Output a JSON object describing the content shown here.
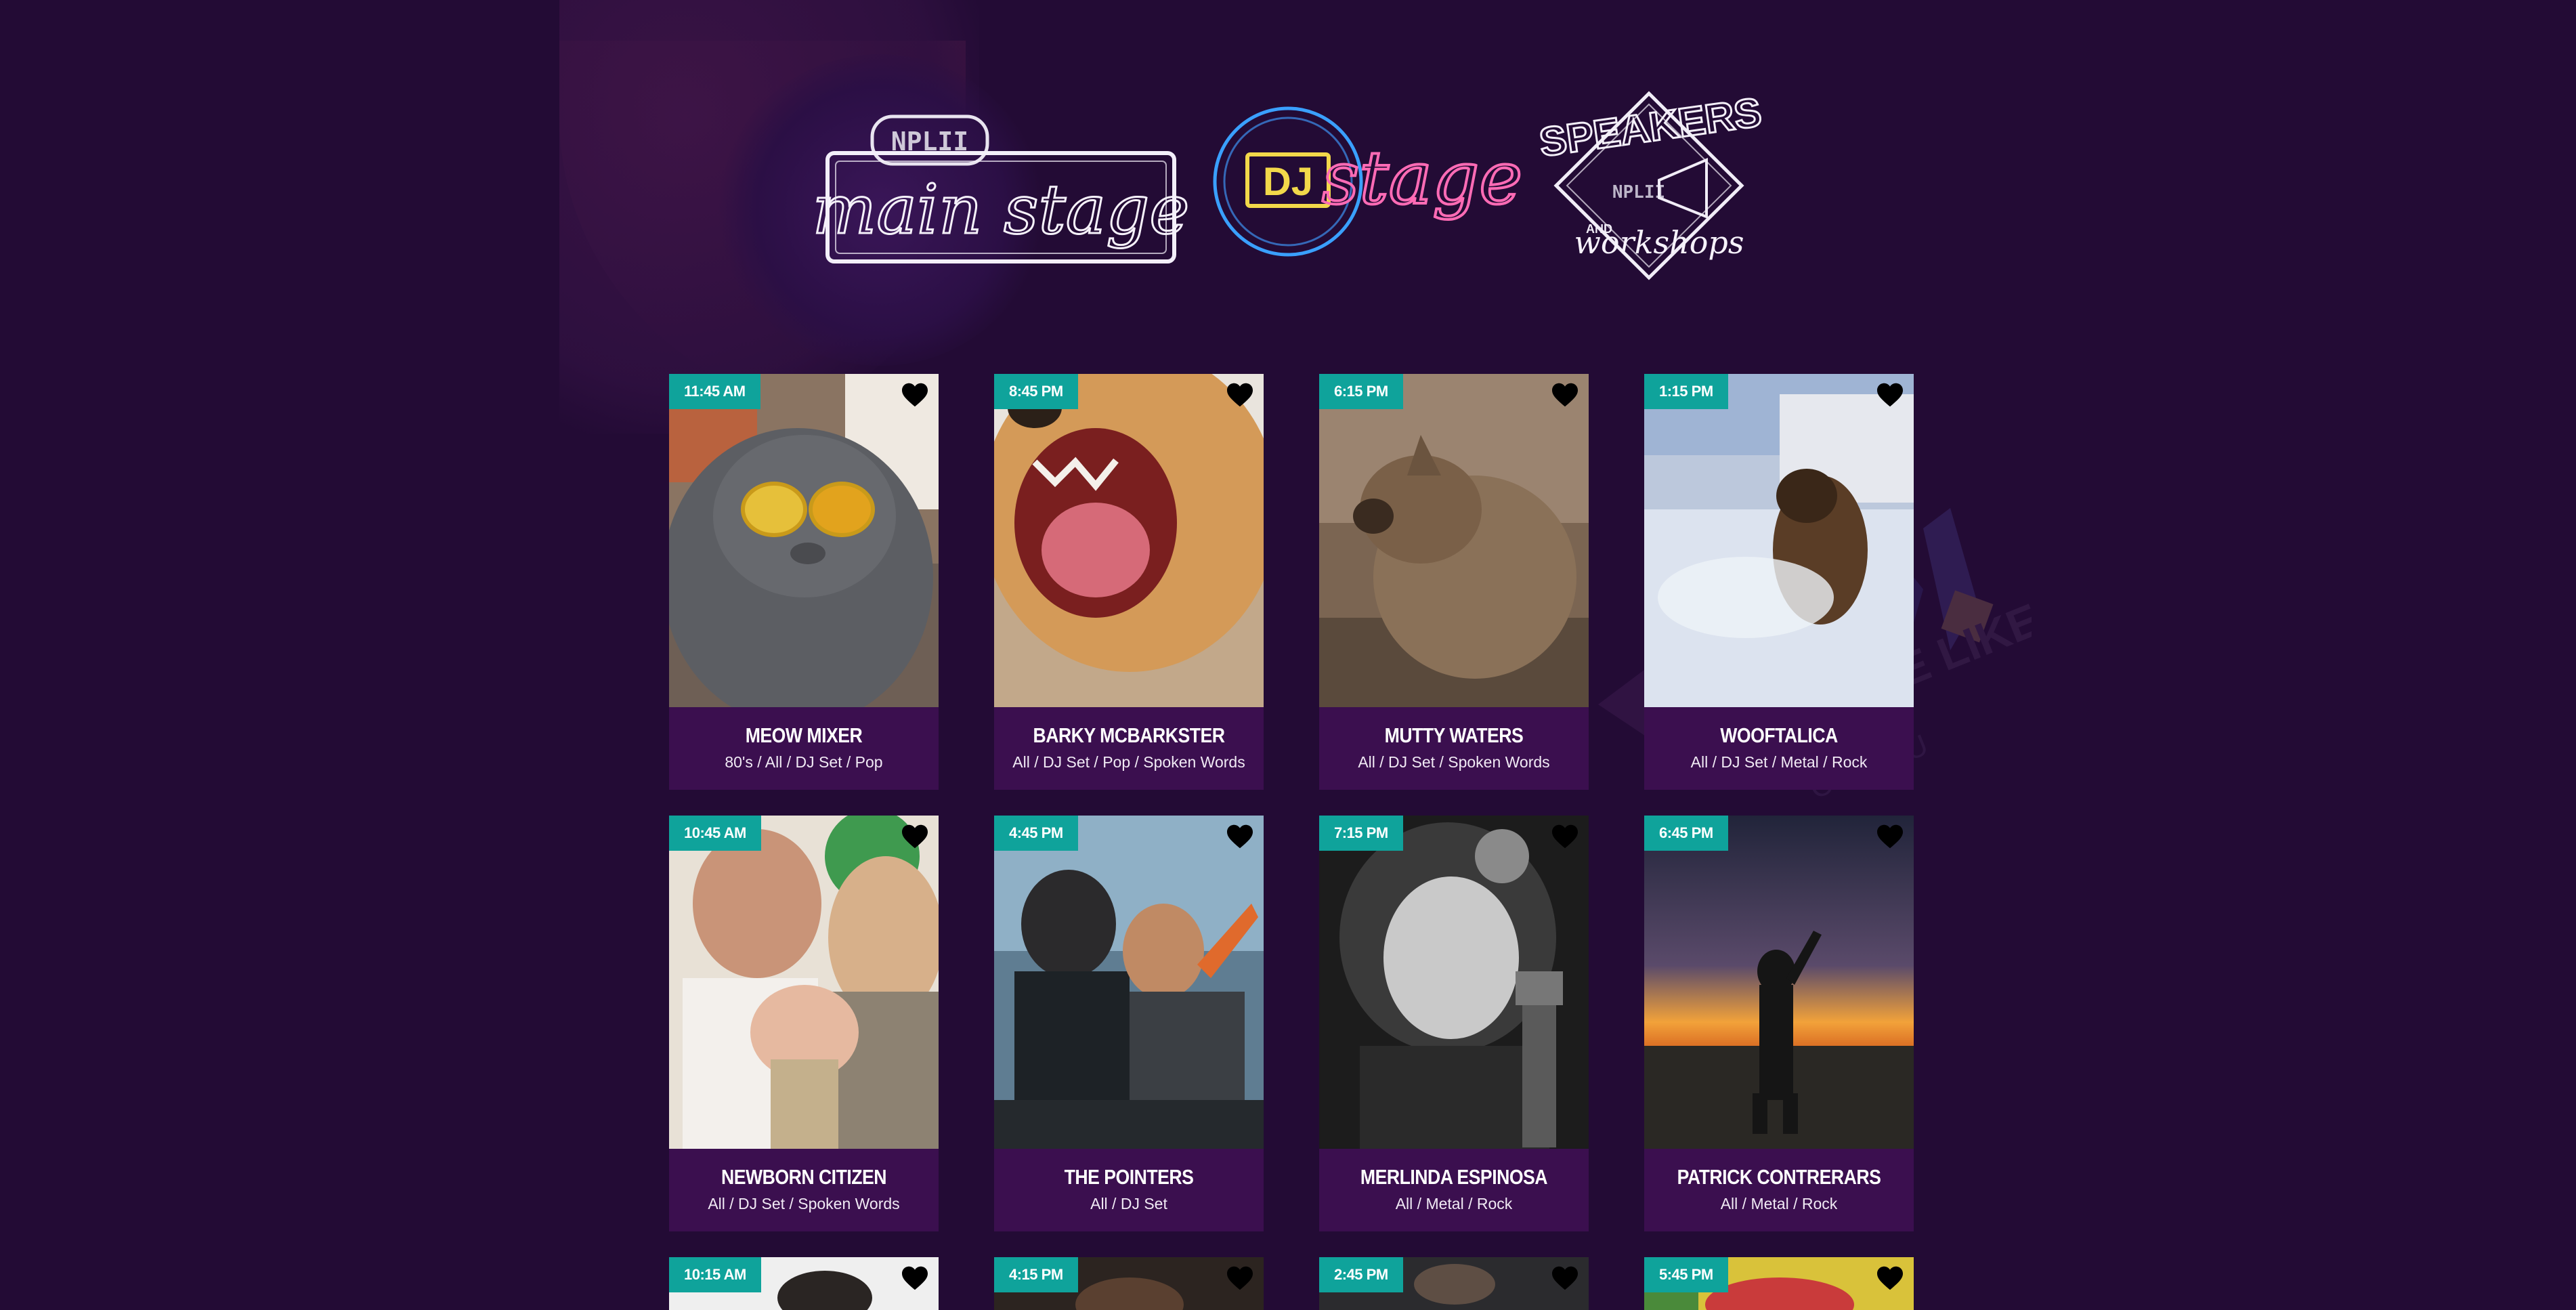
{
  "logos": [
    {
      "id": "main-stage",
      "label": "main stage",
      "badge": "NPLII"
    },
    {
      "id": "dj-stage",
      "label": "stage",
      "badge": "DJ"
    },
    {
      "id": "speakers",
      "label_top": "SPEAKERS",
      "label_and": "AND",
      "label_bottom": "workshops",
      "badge": "NPLII"
    }
  ],
  "watermark": {
    "text": "stage"
  },
  "background_text": {
    "line1": "NO PLACE LIKE",
    "line2": "CULTU"
  },
  "cards": [
    {
      "time": "11:45 AM",
      "name": "MEOW MIXER",
      "genres": "80's / All / DJ Set / Pop",
      "photo": "cat-with-sunglasses"
    },
    {
      "time": "8:45 PM",
      "name": "BARKY MCBARKSTER",
      "genres": "All / DJ Set / Pop / Spoken Words",
      "photo": "dog-barking"
    },
    {
      "time": "6:15 PM",
      "name": "MUTTY WATERS",
      "genres": "All / DJ Set / Spoken Words",
      "photo": "wet-dog-shaking"
    },
    {
      "time": "1:15 PM",
      "name": "WOOFTALICA",
      "genres": "All / DJ Set / Metal / Rock",
      "photo": "dog-in-snow"
    },
    {
      "time": "10:45 AM",
      "name": "NEWBORN CITIZEN",
      "genres": "All / DJ Set / Spoken Words",
      "photo": "family-with-baby"
    },
    {
      "time": "4:45 PM",
      "name": "THE POINTERS",
      "genres": "All / DJ Set",
      "photo": "djs-at-decks"
    },
    {
      "time": "7:15 PM",
      "name": "MERLINDA ESPINOSA",
      "genres": "All / Metal / Rock",
      "photo": "singer-with-guitar"
    },
    {
      "time": "6:45 PM",
      "name": "PATRICK CONTRERARS",
      "genres": "All / Metal / Rock",
      "photo": "violinist-at-sunset"
    },
    {
      "time": "10:15 AM",
      "name": "",
      "genres": "",
      "photo": "man-portrait"
    },
    {
      "time": "4:15 PM",
      "name": "",
      "genres": "",
      "photo": "performer-portrait"
    },
    {
      "time": "2:45 PM",
      "name": "",
      "genres": "",
      "photo": "man-with-cap"
    },
    {
      "time": "5:45 PM",
      "name": "",
      "genres": "",
      "photo": "colorful-performer"
    }
  ],
  "colors": {
    "background": "#230b35",
    "card_info": "#3b0f4f",
    "time_badge": "#0fa39b",
    "heart": "#000000"
  },
  "icons": {
    "favorite": "heart-icon"
  }
}
